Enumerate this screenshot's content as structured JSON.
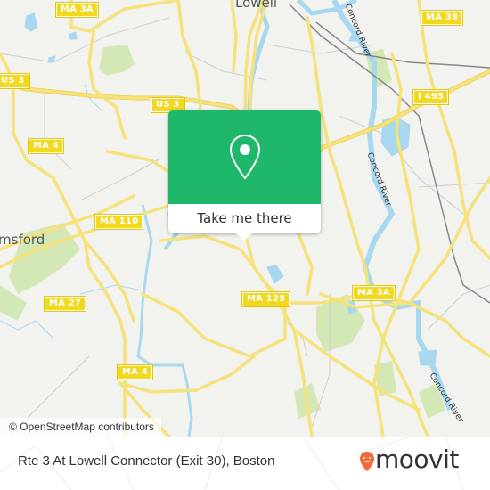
{
  "map": {
    "place_labels": [
      {
        "text": "Lowell",
        "name": "place-label-lowell"
      },
      {
        "text": "msford",
        "name": "place-label-chelmsford"
      }
    ],
    "route_shields": [
      {
        "text": "MA 3A",
        "name": "shield-ma-3a-north"
      },
      {
        "text": "US 3",
        "name": "shield-us-3-west"
      },
      {
        "text": "US 3",
        "name": "shield-us-3-center"
      },
      {
        "text": "MA 38",
        "name": "shield-ma-38"
      },
      {
        "text": "I 495",
        "name": "shield-i-495"
      },
      {
        "text": "MA 4",
        "name": "shield-ma-4-north"
      },
      {
        "text": "MA 110",
        "name": "shield-ma-110"
      },
      {
        "text": "MA 27",
        "name": "shield-ma-27"
      },
      {
        "text": "MA 129",
        "name": "shield-ma-129"
      },
      {
        "text": "MA 3A",
        "name": "shield-ma-3a-south"
      },
      {
        "text": "MA 4",
        "name": "shield-ma-4-south"
      }
    ],
    "river_labels": [
      {
        "text": "Concord River",
        "name": "river-label-north"
      },
      {
        "text": "Concord River",
        "name": "river-label-middle"
      },
      {
        "text": "Concord River",
        "name": "river-label-south"
      }
    ],
    "attribution": "© OpenStreetMap contributors",
    "colors": {
      "land": "#f2f2ee",
      "road": "#f5e27a",
      "road_outline": "#e8cf5a",
      "water": "#a8d8ef",
      "park": "#d4e8b5",
      "rail": "#888888",
      "minor_road": "#cfcfcf"
    }
  },
  "popup": {
    "action_label": "Take me there",
    "icon": "map-pin-icon",
    "color": "#1fb86b"
  },
  "footer": {
    "stop_title": "Rte 3 At Lowell Connector (Exit 30), Boston",
    "brand": "moovit",
    "brand_color": "#f26a3a"
  }
}
